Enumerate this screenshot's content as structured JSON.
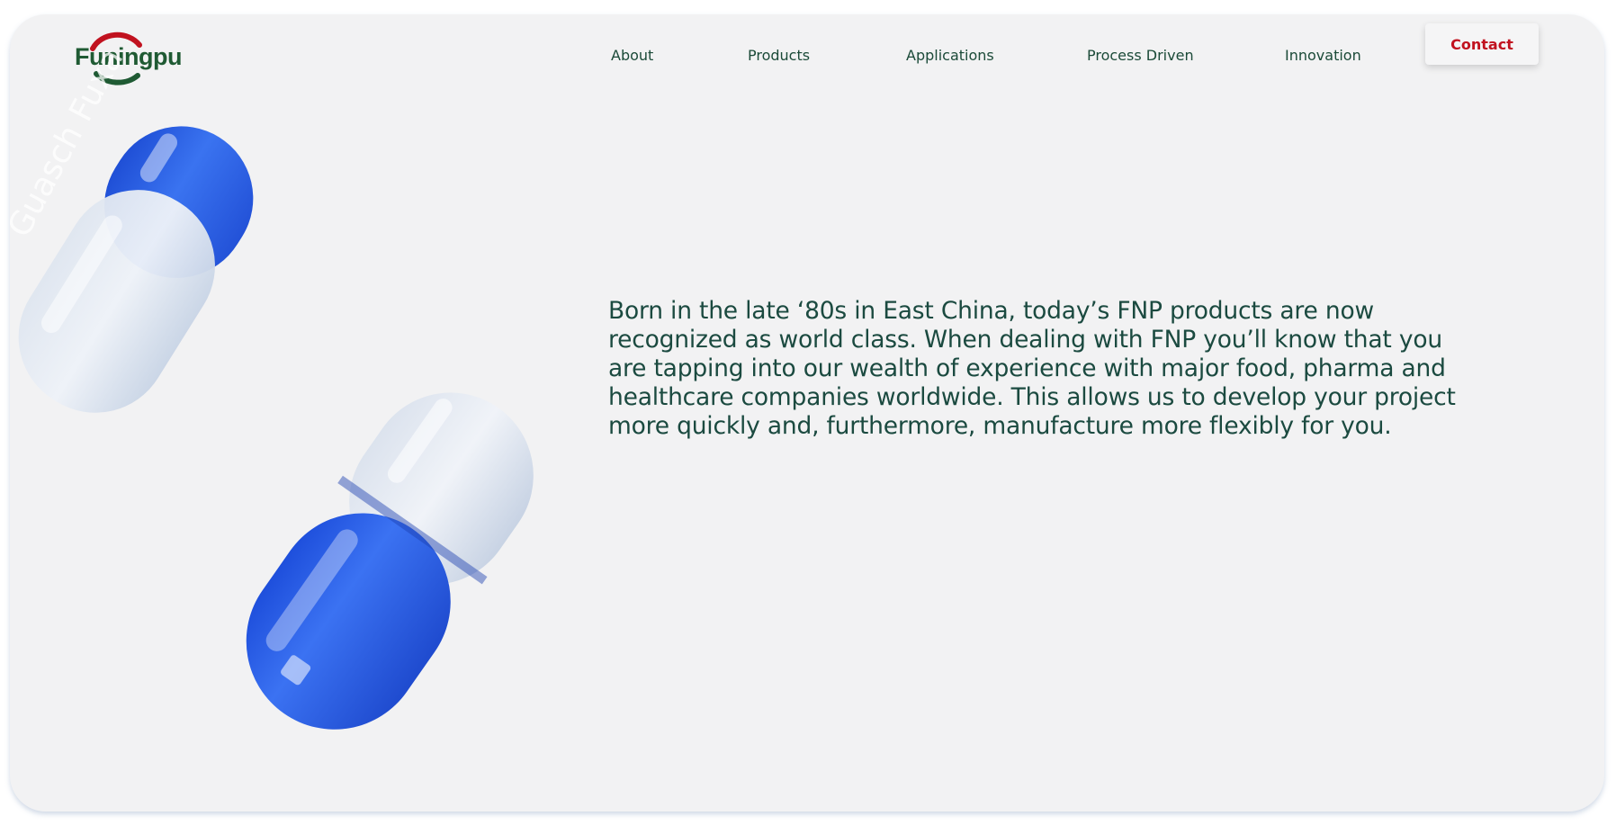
{
  "brand": {
    "name": "Funingpu",
    "colors": {
      "green": "#1f5a33",
      "red": "#c1121f",
      "text": "#1b4a40",
      "capsule_blue": "#2f63e0"
    }
  },
  "nav": {
    "items": [
      {
        "label": "About"
      },
      {
        "label": "Products"
      },
      {
        "label": "Applications"
      },
      {
        "label": "Process Driven"
      },
      {
        "label": "Innovation"
      }
    ],
    "contact_label": "Contact"
  },
  "hero": {
    "text": "Born in the late ‘80s in East China, today’s FNP products are now recognized as world class. When dealing with FNP you’ll know that you are tapping into our wealth of experience with major food, pharma and healthcare companies worldwide. This allows us to develop your project more quickly and, furthermore, manufacture more flexibly for you."
  },
  "images": {
    "capsule_top": "capsule-image",
    "capsule_bottom": "capsule-image",
    "watermark_text": "Guasch Fuxa"
  }
}
